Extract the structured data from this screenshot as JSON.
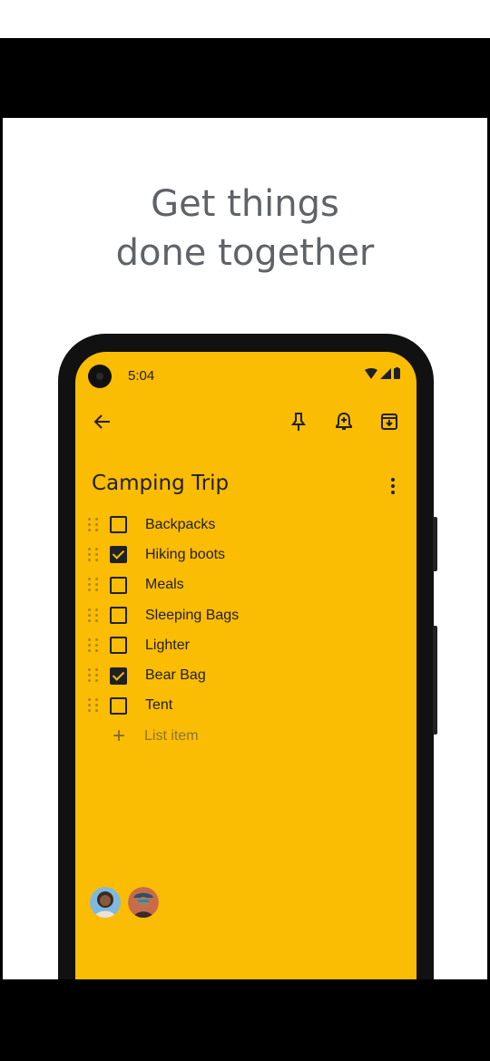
{
  "headline": {
    "line1": "Get things",
    "line2": "done together"
  },
  "status_bar": {
    "time": "5:04"
  },
  "note": {
    "title": "Camping Trip",
    "items": [
      {
        "label": "Backpacks",
        "checked": false
      },
      {
        "label": "Hiking boots",
        "checked": true
      },
      {
        "label": "Meals",
        "checked": false
      },
      {
        "label": "Sleeping Bags",
        "checked": false
      },
      {
        "label": "Lighter",
        "checked": false
      },
      {
        "label": "Bear Bag",
        "checked": true
      },
      {
        "label": "Tent",
        "checked": false
      }
    ],
    "add_item_label": "List item"
  },
  "colors": {
    "note_background": "#fbbc04",
    "headline_text": "#5f6368",
    "ink": "#202124"
  },
  "icons": {
    "back": "arrow-left-icon",
    "pin": "pin-icon",
    "reminder": "bell-plus-icon",
    "archive": "archive-icon",
    "more": "more-vert-icon",
    "add": "add-box-icon",
    "undo": "undo-icon",
    "redo": "redo-icon"
  }
}
